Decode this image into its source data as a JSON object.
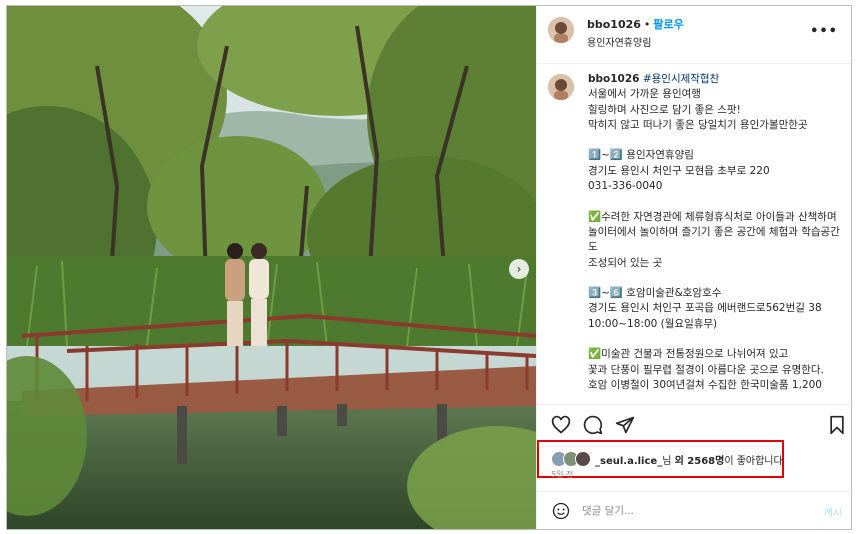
{
  "post": {
    "username": "bbo1026",
    "separator": "•",
    "follow_label": "팔로우",
    "location": "용인자연휴양림",
    "more_icon": "more-horizontal-icon",
    "caption": {
      "username": "bbo1026",
      "hashtag": "#용인시제작협찬",
      "body": "서울에서 가까운 용인여행\n힐링하며 사진으로 담기 좋은 스팟!\n막히지 않고 떠나기 좋은 당일치기 용인가볼만한곳\n\n1️⃣~2️⃣ 용인자연휴양림\n경기도 용인시 처인구 모현읍 초부로 220\n031-336-0040\n\n✅수려한 자연경관에 체류형휴식처로 아이들과 산책하며\n놀이터에서 놀이하며 즐기기 좋은 공간에 체험과 학습공간도\n조성되어 있는 곳\n\n3️⃣~6️⃣ 호암미술관&호암호수\n경기도 용인시 처인구 포곡읍 에버랜드로562번길 38\n10:00~18:00 (월요일휴무)\n\n✅미술관 건물과 전통정원으로 나뉘어져 있고\n꽃과 단풍이 필무렵 절경이 아름다운 곳으로 유명한다.\n호암 이병철이 30여년걸쳐 수집한 한국미술품 1,200"
    }
  },
  "actions": {
    "like_icon": "heart-icon",
    "comment_icon": "comment-icon",
    "share_icon": "send-icon",
    "save_icon": "bookmark-icon"
  },
  "likes": {
    "liker": "_seul.a.lice_",
    "suffix_1": "님 ",
    "others": "외 2568명",
    "suffix_2": "이 좋아합니다",
    "time_ago": "5일 전"
  },
  "comment": {
    "emoji_icon": "emoji-icon",
    "placeholder": "댓글 달기...",
    "post_label": "게시"
  },
  "carousel": {
    "next_icon": "chevron-right-icon",
    "next_glyph": "›"
  },
  "colors": {
    "follow": "#0095f6",
    "highlight_border": "#e00000",
    "hashtag": "#00376b",
    "deck_rail": "#8b3a2e"
  }
}
